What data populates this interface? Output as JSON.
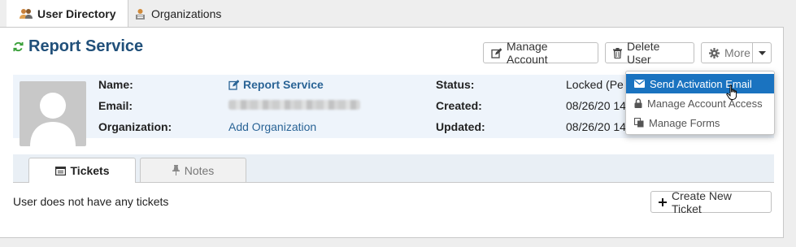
{
  "top_tabs": [
    {
      "label": "User Directory",
      "icon": "users-icon",
      "active": true
    },
    {
      "label": "Organizations",
      "icon": "organization-icon",
      "active": false
    }
  ],
  "header": {
    "title": "Report Service",
    "title_icon": "refresh-icon"
  },
  "toolbar": {
    "manage_account_label": "Manage Account",
    "delete_user_label": "Delete User",
    "more_label": "More"
  },
  "details": {
    "name_label": "Name:",
    "name_value": "Report Service",
    "email_label": "Email:",
    "email_value": "",
    "organization_label": "Organization:",
    "organization_value": "Add Organization",
    "status_label": "Status:",
    "status_value": "Locked (Pe",
    "created_label": "Created:",
    "created_value": "08/26/20 14",
    "updated_label": "Updated:",
    "updated_value": "08/26/20 14"
  },
  "more_menu": [
    {
      "label": "Send Activation Email",
      "icon": "envelope-icon",
      "highlighted": true
    },
    {
      "label": "Manage Account Access",
      "icon": "lock-icon",
      "highlighted": false
    },
    {
      "label": "Manage Forms",
      "icon": "copy-icon",
      "highlighted": false
    }
  ],
  "sub_tabs": [
    {
      "label": "Tickets",
      "icon": "ticket-icon",
      "active": true
    },
    {
      "label": "Notes",
      "icon": "pin-icon",
      "active": false
    }
  ],
  "tickets": {
    "empty_message": "User does not have any tickets",
    "create_button_label": "Create New Ticket"
  },
  "colors": {
    "title": "#21507a",
    "link": "#2a6496",
    "menu_highlight": "#1a73c0",
    "refresh_icon": "#3aa03a"
  }
}
